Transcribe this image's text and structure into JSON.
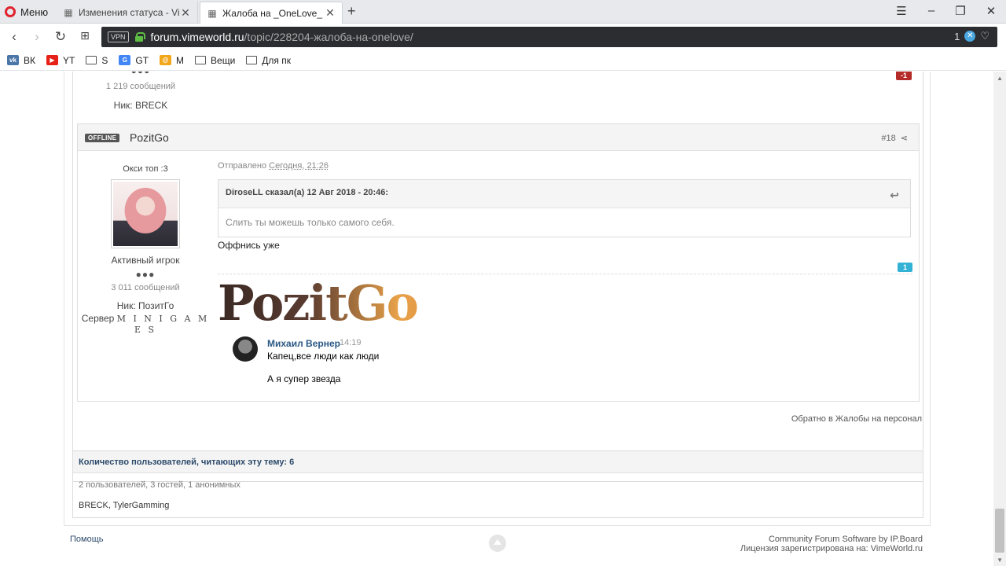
{
  "browser": {
    "menu_label": "Меню",
    "tabs": [
      {
        "title": "Изменения статуса - Vime",
        "close": "✕"
      },
      {
        "title": "Жалоба на _OneLove_ - V",
        "close": "✕"
      }
    ],
    "new_tab": "+",
    "url_host": "forum.vimeworld.ru",
    "url_path": "/topic/228204-жалоба-на-onelove/",
    "vpn_label": "VPN",
    "adblock_count": "1",
    "bookmarks": [
      {
        "label": "ВК",
        "icon": "vk-icon",
        "color": "#4a76a8"
      },
      {
        "label": "YT",
        "icon": "youtube-icon",
        "color": "#e62117"
      },
      {
        "label": "S",
        "icon": "folder-icon",
        "color": ""
      },
      {
        "label": "GT",
        "icon": "google-translate-icon",
        "color": "#4285f4"
      },
      {
        "label": "M",
        "icon": "mail-icon",
        "color": "#f2a61a"
      },
      {
        "label": "Вещи",
        "icon": "folder-icon",
        "color": ""
      },
      {
        "label": "Для пк",
        "icon": "folder-icon",
        "color": ""
      }
    ]
  },
  "prev_post": {
    "pips": "●●●",
    "post_count": "1 219 сообщений",
    "nick": "Ник: BRECK",
    "reputation": "-1"
  },
  "post": {
    "status_badge": "OFFLINE",
    "author": "PozitGo",
    "number": "#18",
    "user_title": "Окси топ :3",
    "rank": "Активный игрок",
    "pips": "●●●",
    "post_count": "3 011 сообщений",
    "nick": "Ник: ПозитГо",
    "server_label": "Сервер",
    "server_value": "M I N I G A M E S",
    "posted_prefix": "Отправлено",
    "posted_when": "Сегодня, 21:26",
    "quote_header": "DiroseLL сказал(а) 12 Авг 2018 - 20:46:",
    "quote_text": "Слить ты можешь только самого себя.",
    "text": "Оффнись уже",
    "reputation": "1",
    "signature": {
      "logo_text": "PozitGo",
      "chat_name": "Михаил Вернер",
      "chat_time": "14:19",
      "chat_line1": "Капец,все люди как люди",
      "chat_line2": "А я супер звезда"
    }
  },
  "back_link": "Обратно в Жалобы на персонал",
  "readers": {
    "title": "Количество пользователей, читающих эту тему: 6",
    "stats": "2 пользователей, 3 гостей, 1 анонимных",
    "list": "BRECK, TylerGamming"
  },
  "footer": {
    "help": "Помощь",
    "software": "Community Forum Software by IP.Board",
    "license": "Лицензия зарегистрирована на: VimeWorld.ru"
  }
}
